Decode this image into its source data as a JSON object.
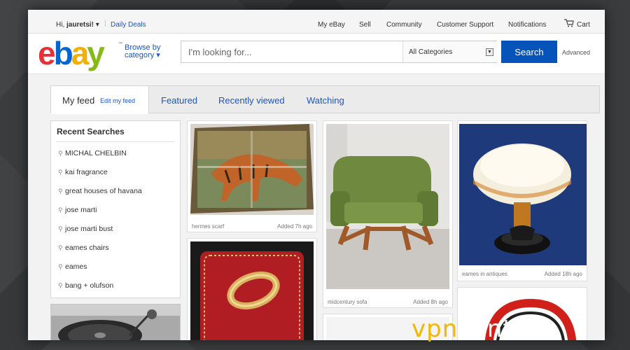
{
  "topbar": {
    "greeting_prefix": "Hi,",
    "username": "jauretsi!",
    "greeting_caret": "▾",
    "daily_deals": "Daily Deals",
    "nav": [
      "My eBay",
      "Sell",
      "Community",
      "Customer Support",
      "Notifications"
    ],
    "cart": "Cart"
  },
  "header": {
    "logo": "ebay",
    "logo_tm": "™",
    "browse_line1": "Browse by",
    "browse_line2": "category ▾",
    "search_placeholder": "I'm looking for...",
    "category_value": "All Categories",
    "search_button": "Search",
    "advanced": "Advanced"
  },
  "tabs": {
    "active": "My feed",
    "edit": "Edit my feed",
    "items": [
      "Featured",
      "Recently viewed",
      "Watching"
    ]
  },
  "sidebar": {
    "title": "Recent Searches",
    "items": [
      "MICHAL CHELBIN",
      "kai fragrance",
      "great houses of havana",
      "jose marti",
      "jose marti bust",
      "eames chairs",
      "eames",
      "bang + olufson"
    ]
  },
  "cards": [
    {
      "caption": "hermes scarf",
      "added": "Added 7h ago"
    },
    {
      "caption": "midcentury sofa",
      "added": "Added 8h ago"
    },
    {
      "caption": "eames in antiques",
      "added": "Added 18h ago"
    }
  ],
  "watermark": {
    "part1": "vpn",
    "part2": "central"
  },
  "colors": {
    "search_button": "#0654ba",
    "link": "#1a56c8",
    "watermark": "#f2b705"
  }
}
